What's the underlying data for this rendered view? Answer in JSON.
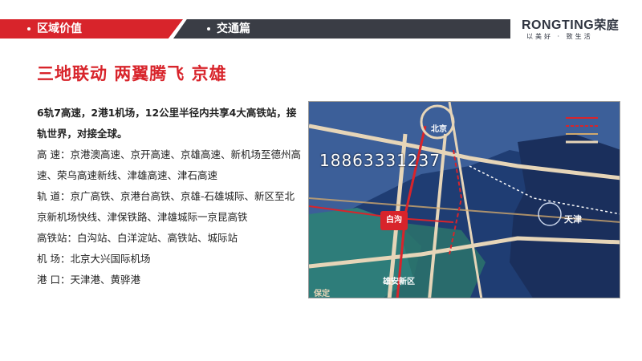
{
  "header": {
    "section_label": "区域价值",
    "subsection_label": "交通篇"
  },
  "brand": {
    "name": "RONGTING",
    "name_cn": "荣庭",
    "slogan": "以美好 · 致生活"
  },
  "title": "三地联动 两翼腾飞 京雄",
  "intro": "6轨7高速，2港1机场，12公里半径内共享4大高铁站，接轨世界，对接全球。",
  "lines": [
    "高 速：京港澳高速、京开高速、京雄高速、新机场至德州高速、荣乌高速新线、津雄高速、津石高速",
    "轨 道：京广高铁、京港台高铁、京雄-石雄城际、新区至北京新机场快线、津保铁路、津雄城际一京昆高铁",
    "高铁站：白沟站、白洋淀站、高铁站、城际站",
    "机 场：北京大兴国际机场",
    "港 口：天津港、黄骅港"
  ],
  "map": {
    "labels": {
      "beijing": "北京",
      "tianjin": "天津",
      "baigou": "白沟",
      "xiongan": "雄安新区",
      "baoding": "保定"
    },
    "watermark": "18863331237"
  },
  "colors": {
    "accent": "#d8242b",
    "dark": "#3a3d45",
    "map_bg": "#1f3d73",
    "xiongan": "#2e7d7a"
  }
}
